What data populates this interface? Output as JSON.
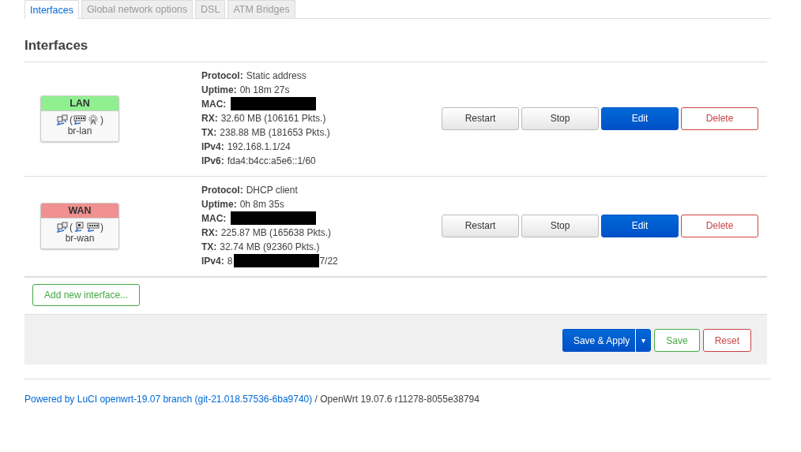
{
  "tabs": [
    {
      "label": "Interfaces",
      "selected": true
    },
    {
      "label": "Global network options",
      "selected": false
    },
    {
      "label": "DSL",
      "selected": false
    },
    {
      "label": "ATM Bridges",
      "selected": false
    }
  ],
  "section": {
    "title": "Interfaces"
  },
  "interfaces": [
    {
      "name": "LAN",
      "color": "#90f090",
      "bracket_open": "(",
      "bracket_close": ")",
      "devices": [
        {
          "kind": "switch"
        },
        {
          "kind": "wireless"
        }
      ],
      "device": "br-lan",
      "info": [
        {
          "label": "Protocol:",
          "value": "Static address"
        },
        {
          "label": "Uptime:",
          "value": "0h 18m 27s"
        },
        {
          "label": "MAC:",
          "redacted": true
        },
        {
          "label": "RX:",
          "value": "32.60 MB (106161 Pkts.)"
        },
        {
          "label": "TX:",
          "value": "238.88 MB (181653 Pkts.)"
        },
        {
          "label": "IPv4:",
          "value": "192.168.1.1/24"
        },
        {
          "label": "IPv6:",
          "value": "fda4:b4cc:a5e6::1/60"
        }
      ],
      "buttons": [
        {
          "label": "Restart",
          "kind": "default"
        },
        {
          "label": "Stop",
          "kind": "default"
        },
        {
          "label": "Edit",
          "kind": "primary"
        },
        {
          "label": "Delete",
          "kind": "negative"
        }
      ]
    },
    {
      "name": "WAN",
      "color": "#f09090",
      "bracket_open": "(",
      "bracket_close": ")",
      "devices": [
        {
          "kind": "port"
        },
        {
          "kind": "switch"
        }
      ],
      "device": "br-wan",
      "info": [
        {
          "label": "Protocol:",
          "value": "DHCP client"
        },
        {
          "label": "Uptime:",
          "value": "0h 8m 35s"
        },
        {
          "label": "MAC:",
          "redacted": true
        },
        {
          "label": "RX:",
          "value": "225.87 MB (165638 Pkts.)"
        },
        {
          "label": "TX:",
          "value": "32.74 MB (92360 Pkts.)"
        },
        {
          "label": "IPv4:",
          "redacted": true,
          "before": "8",
          "after": "7/22"
        }
      ],
      "buttons": [
        {
          "label": "Restart",
          "kind": "default"
        },
        {
          "label": "Stop",
          "kind": "default"
        },
        {
          "label": "Edit",
          "kind": "primary"
        },
        {
          "label": "Delete",
          "kind": "negative"
        }
      ]
    }
  ],
  "add_button": {
    "label": "Add new interface...",
    "kind": "positive"
  },
  "actions": [
    {
      "label": "Save & Apply",
      "kind": "primary",
      "caret": "▾"
    },
    {
      "label": "Save",
      "kind": "positive"
    },
    {
      "label": "Reset",
      "kind": "negative"
    }
  ],
  "footer": {
    "link": "Powered by LuCI openwrt-19.07 branch (git-21.018.57536-6ba9740)",
    "text": "/ OpenWrt 19.07.6 r11278-8055e38794"
  }
}
